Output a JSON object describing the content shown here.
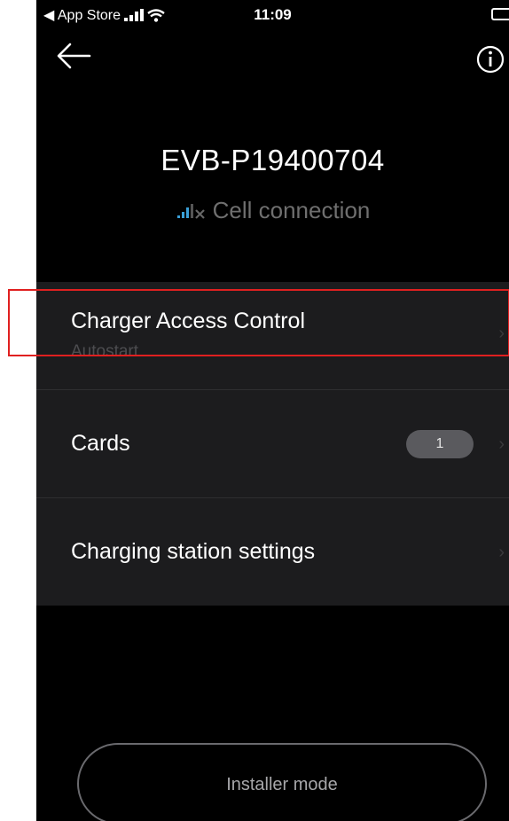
{
  "status_bar": {
    "back_app": "◀ App Store",
    "time": "11:09"
  },
  "header": {
    "title": "EVB-P19400704",
    "connection": "Cell connection"
  },
  "menu": {
    "items": [
      {
        "title": "Charger Access Control",
        "subtitle": "Autostart"
      },
      {
        "title": "Cards",
        "badge": "1"
      },
      {
        "title": "Charging station settings"
      }
    ]
  },
  "footer": {
    "installer_button": "Installer mode"
  },
  "colors": {
    "background": "#000000",
    "list_background": "#1c1c1e",
    "highlight": "#e02020",
    "signal_accent": "#3aa0d8"
  }
}
